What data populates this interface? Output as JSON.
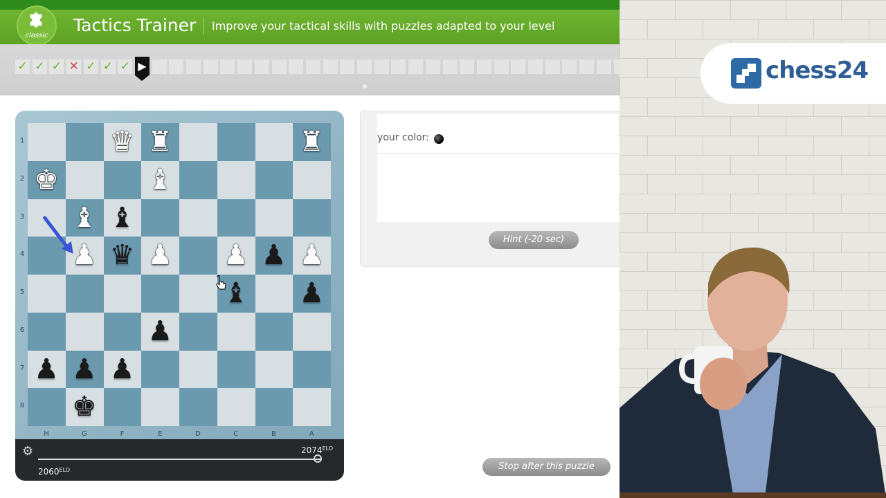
{
  "header": {
    "logo_label": "classic",
    "title": "Tactics Trainer",
    "subtitle": "Improve your tactical skills with puzzles adapted to your level"
  },
  "progress": {
    "results": [
      "ok",
      "ok",
      "ok",
      "fail",
      "ok",
      "ok",
      "ok"
    ],
    "current_index": 7,
    "total_cells": 36
  },
  "board": {
    "orientation": "black",
    "files": [
      "H",
      "G",
      "F",
      "E",
      "D",
      "C",
      "B",
      "A"
    ],
    "ranks": [
      "1",
      "2",
      "3",
      "4",
      "5",
      "6",
      "7",
      "8"
    ],
    "pieces": [
      {
        "square": "f1",
        "piece": "Q",
        "color": "white"
      },
      {
        "square": "e1",
        "piece": "R",
        "color": "white"
      },
      {
        "square": "a1",
        "piece": "R",
        "color": "white"
      },
      {
        "square": "h2",
        "piece": "K",
        "color": "white"
      },
      {
        "square": "e2",
        "piece": "B",
        "color": "white"
      },
      {
        "square": "g3",
        "piece": "B",
        "color": "white"
      },
      {
        "square": "f3",
        "piece": "B",
        "color": "black"
      },
      {
        "square": "g4",
        "piece": "P",
        "color": "white"
      },
      {
        "square": "f4",
        "piece": "Q",
        "color": "black"
      },
      {
        "square": "e4",
        "piece": "P",
        "color": "white"
      },
      {
        "square": "c4",
        "piece": "P",
        "color": "white"
      },
      {
        "square": "b4",
        "piece": "P",
        "color": "black"
      },
      {
        "square": "a4",
        "piece": "P",
        "color": "white"
      },
      {
        "square": "c5",
        "piece": "B",
        "color": "black"
      },
      {
        "square": "a5",
        "piece": "P",
        "color": "black"
      },
      {
        "square": "e6",
        "piece": "P",
        "color": "black"
      },
      {
        "square": "h7",
        "piece": "P",
        "color": "black"
      },
      {
        "square": "g7",
        "piece": "P",
        "color": "black"
      },
      {
        "square": "f7",
        "piece": "P",
        "color": "black"
      },
      {
        "square": "g8",
        "piece": "K",
        "color": "black"
      }
    ],
    "last_move_arrow": {
      "from": "h3",
      "to": "g4",
      "color": "#3a54d6"
    }
  },
  "rating": {
    "current": "2074",
    "start": "2060",
    "suffix": "ELO"
  },
  "panel": {
    "color_label": "your color:",
    "player_color": "black",
    "hint_label": "Hint (-20 sec)"
  },
  "controls": {
    "stop_label": "Stop after this puzzle"
  },
  "video": {
    "brand": "chess24"
  }
}
